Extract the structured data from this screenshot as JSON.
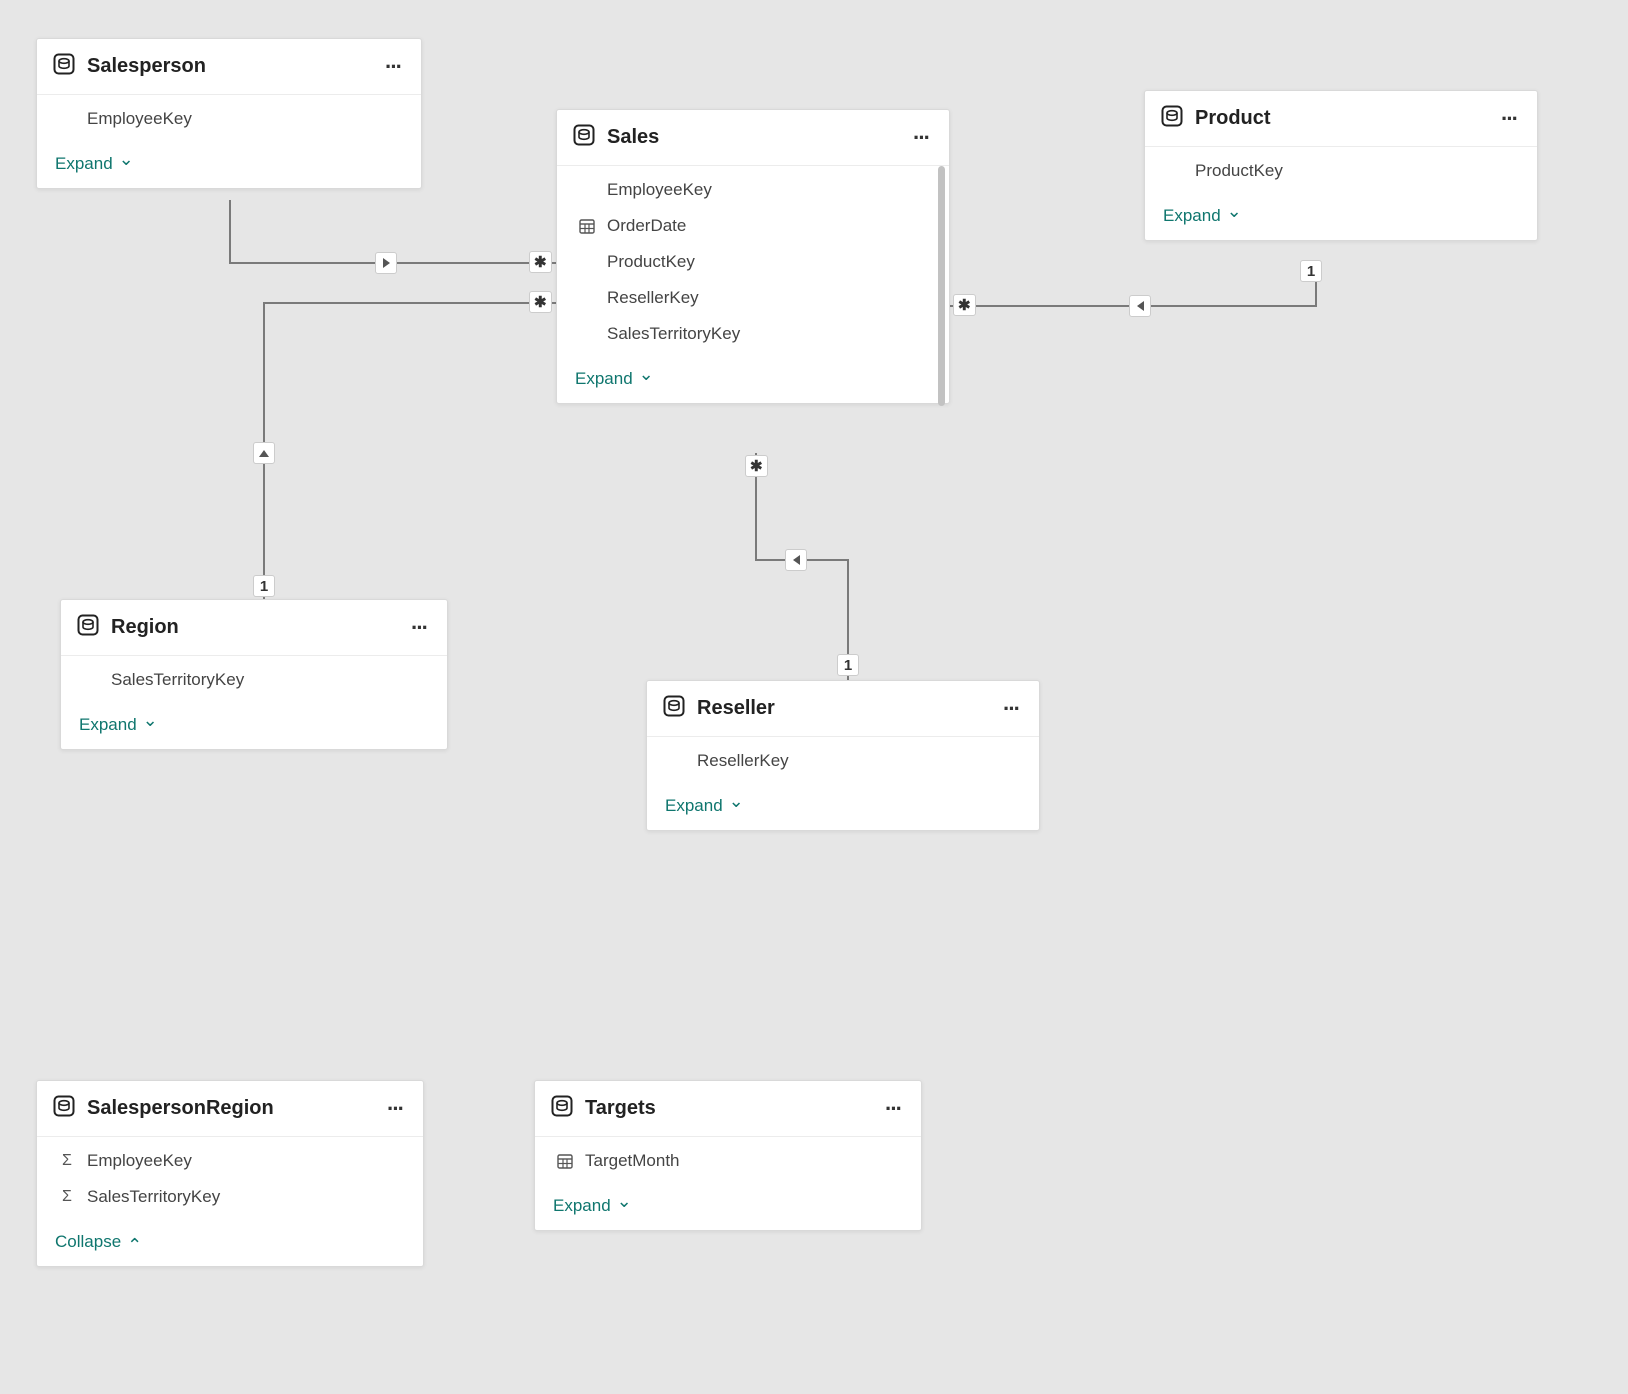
{
  "ui": {
    "expand": "Expand",
    "collapse": "Collapse"
  },
  "symbols": {
    "one": "1",
    "many": "✱"
  },
  "tables": {
    "salesperson": {
      "title": "Salesperson",
      "fields": [
        "EmployeeKey"
      ],
      "toggle": "expand"
    },
    "sales": {
      "title": "Sales",
      "fields": [
        "EmployeeKey",
        "OrderDate",
        "ProductKey",
        "ResellerKey",
        "SalesTerritoryKey"
      ],
      "fieldIcons": [
        "",
        "table",
        "",
        "",
        ""
      ],
      "toggle": "expand"
    },
    "product": {
      "title": "Product",
      "fields": [
        "ProductKey"
      ],
      "toggle": "expand"
    },
    "region": {
      "title": "Region",
      "fields": [
        "SalesTerritoryKey"
      ],
      "toggle": "expand"
    },
    "reseller": {
      "title": "Reseller",
      "fields": [
        "ResellerKey"
      ],
      "toggle": "expand"
    },
    "salespersonregion": {
      "title": "SalespersonRegion",
      "fields": [
        "EmployeeKey",
        "SalesTerritoryKey"
      ],
      "fieldIcons": [
        "sigma",
        "sigma"
      ],
      "toggle": "collapse"
    },
    "targets": {
      "title": "Targets",
      "fields": [
        "TargetMonth"
      ],
      "fieldIcons": [
        "table"
      ],
      "toggle": "expand"
    }
  },
  "relationships": [
    {
      "from": "salesperson",
      "to": "sales",
      "fromCard": "1-implied",
      "toCard": "many",
      "filterArrow": "right"
    },
    {
      "from": "region",
      "to": "sales",
      "fromCard": "1",
      "toCard": "many",
      "filterArrow": "up"
    },
    {
      "from": "product",
      "to": "sales",
      "fromCard": "1",
      "toCard": "many",
      "filterArrow": "left"
    },
    {
      "from": "reseller",
      "to": "sales",
      "fromCard": "1",
      "toCard": "many",
      "filterArrow": "left-up"
    }
  ]
}
